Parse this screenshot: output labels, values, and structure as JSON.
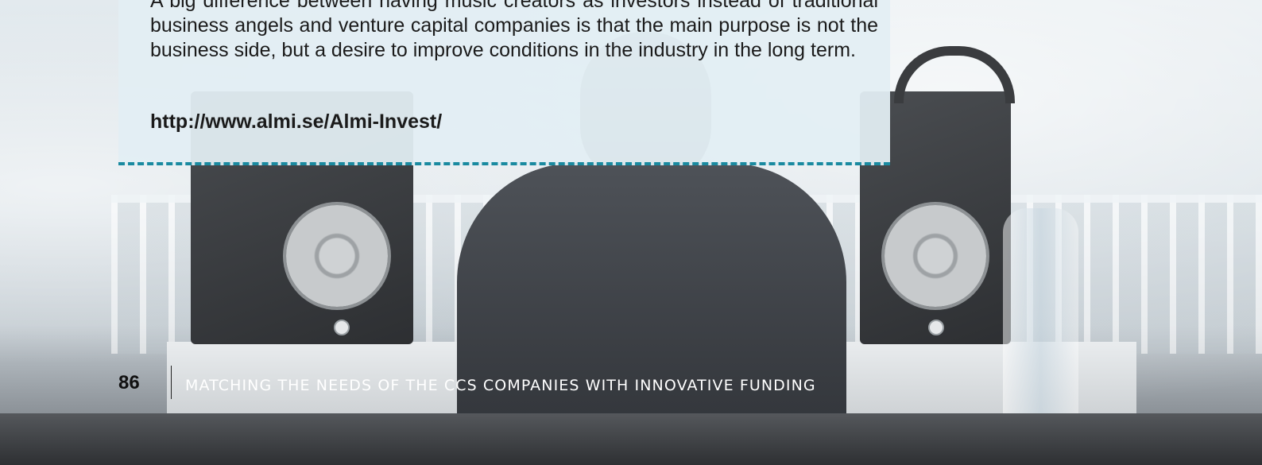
{
  "callout": {
    "body": "A big difference between having music creators as investors instead of traditional business angels and venture capital companies is that the main purpose is not the business side, but a desire to improve conditions in the industry in the long term.",
    "link": "http://www.almi.se/Almi-Invest/"
  },
  "footer": {
    "page_number": "86",
    "running_title": "MATCHING THE NEEDS OF THE CCS COMPANIES WITH INNOVATIVE FUNDING"
  },
  "colors": {
    "accent_dashed_rule": "#1a8aa0",
    "callout_background": "#e2eef3"
  }
}
